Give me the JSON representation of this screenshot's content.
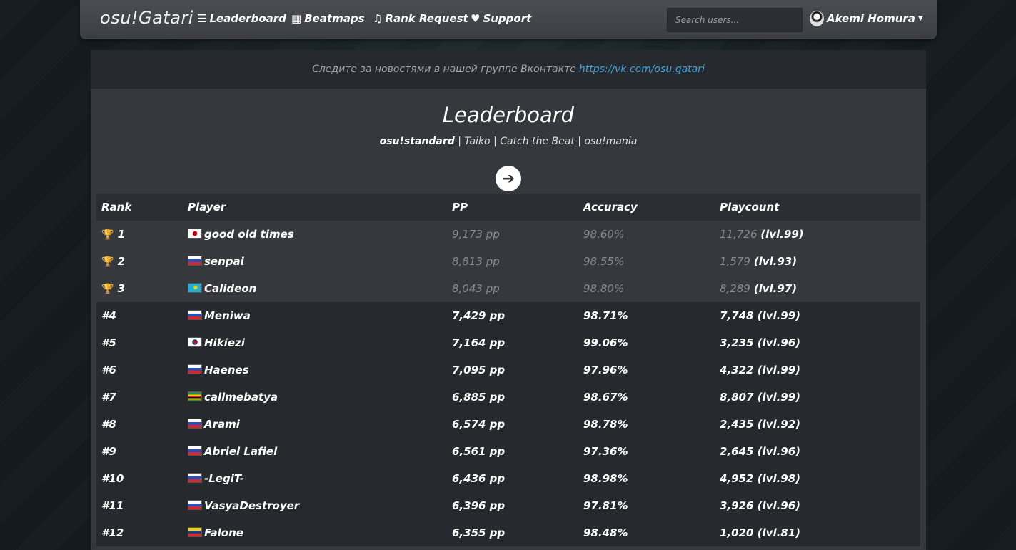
{
  "navbar": {
    "brand": "osu!Gatari",
    "items": [
      {
        "label": "Leaderboard",
        "icon": "list-icon"
      },
      {
        "label": "Beatmaps",
        "icon": "grid-icon"
      },
      {
        "label": "Rank Request",
        "icon": "music-note-icon"
      },
      {
        "label": "Support",
        "icon": "heart-icon"
      }
    ],
    "search_placeholder": "Search users...",
    "username": "Akemi Homura"
  },
  "announcement": {
    "text": "Следите за новостями в нашей группе Вконтакте",
    "link": "https://vk.com/osu.gatari"
  },
  "page": {
    "title": "Leaderboard",
    "modes": [
      "osu!standard",
      "Taiko",
      "Catch the Beat",
      "osu!mania"
    ],
    "active_mode": "osu!standard",
    "separator": "|"
  },
  "table": {
    "headers": [
      "Rank",
      "Player",
      "PP",
      "Accuracy",
      "Playcount"
    ],
    "rows": [
      {
        "rank": "1",
        "flag": "jp",
        "player": "good old times",
        "pp": "9,173 pp",
        "accuracy": "98.60%",
        "playcount": "11,726",
        "level": "(lvl.99)"
      },
      {
        "rank": "2",
        "flag": "ru",
        "player": "senpai",
        "pp": "8,813 pp",
        "accuracy": "98.55%",
        "playcount": "1,579",
        "level": "(lvl.93)"
      },
      {
        "rank": "3",
        "flag": "kz",
        "player": "Calideon",
        "pp": "8,043 pp",
        "accuracy": "98.80%",
        "playcount": "8,289",
        "level": "(lvl.97)"
      },
      {
        "rank": "#4",
        "flag": "ru",
        "player": "Meniwa",
        "pp": "7,429 pp",
        "accuracy": "98.71%",
        "playcount": "7,748",
        "level": "(lvl.99)"
      },
      {
        "rank": "#5",
        "flag": "kr",
        "player": "Hikiezi",
        "pp": "7,164 pp",
        "accuracy": "99.06%",
        "playcount": "3,235",
        "level": "(lvl.96)"
      },
      {
        "rank": "#6",
        "flag": "ru",
        "player": "Haenes",
        "pp": "7,095 pp",
        "accuracy": "97.96%",
        "playcount": "4,322",
        "level": "(lvl.99)"
      },
      {
        "rank": "#7",
        "flag": "zw",
        "player": "callmebatya",
        "pp": "6,885 pp",
        "accuracy": "98.67%",
        "playcount": "8,807",
        "level": "(lvl.99)"
      },
      {
        "rank": "#8",
        "flag": "ru",
        "player": "Arami",
        "pp": "6,574 pp",
        "accuracy": "98.78%",
        "playcount": "2,435",
        "level": "(lvl.92)"
      },
      {
        "rank": "#9",
        "flag": "ru",
        "player": "Abriel Lafiel",
        "pp": "6,561 pp",
        "accuracy": "97.36%",
        "playcount": "2,645",
        "level": "(lvl.96)"
      },
      {
        "rank": "#10",
        "flag": "ru",
        "player": "-LegiT-",
        "pp": "6,436 pp",
        "accuracy": "98.98%",
        "playcount": "4,952",
        "level": "(lvl.98)"
      },
      {
        "rank": "#11",
        "flag": "ru",
        "player": "VasyaDestroyer",
        "pp": "6,396 pp",
        "accuracy": "97.81%",
        "playcount": "3,926",
        "level": "(lvl.96)"
      },
      {
        "rank": "#12",
        "flag": "ve",
        "player": "Falone",
        "pp": "6,355 pp",
        "accuracy": "98.48%",
        "playcount": "1,020",
        "level": "(lvl.81)"
      }
    ]
  },
  "colors": {
    "link": "#3fa8e0",
    "navbar": "#44474b",
    "panel": "#35383c",
    "row_dark": "#26292d"
  }
}
